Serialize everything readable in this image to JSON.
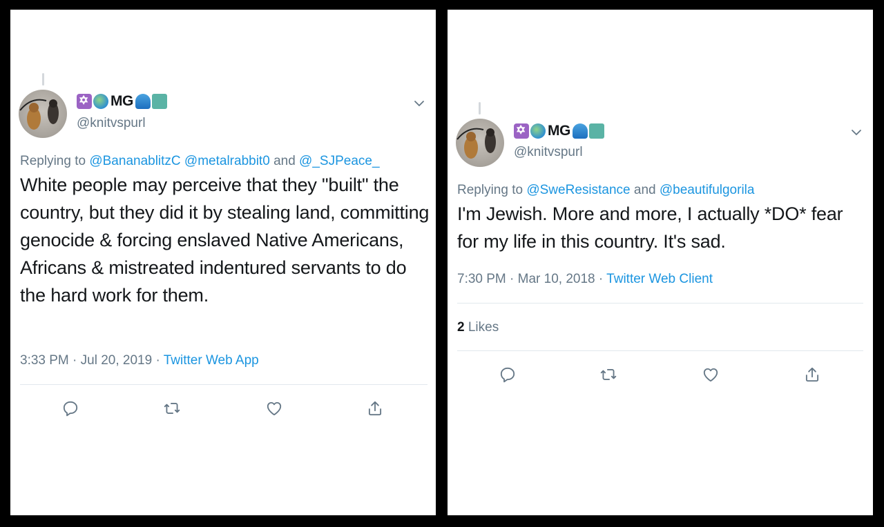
{
  "tweets": [
    {
      "display_name": "MG",
      "handle": "@knitvspurl",
      "replying_prefix": "Replying to",
      "replying_to": "@BananablitzC @metalrabbit0",
      "replying_and": "and",
      "replying_last": "@_SJPeace_",
      "text": "White people may perceive that they \"built\" the country, but they did it by stealing land, committing genocide & forcing enslaved Native Americans, Africans & mistreated indentured servants to do the hard work for them.",
      "time": "3:33 PM",
      "date": "Jul 20, 2019",
      "separator": "·",
      "source": "Twitter Web App",
      "likes_count": null,
      "likes_label": null
    },
    {
      "display_name": "MG",
      "handle": "@knitvspurl",
      "replying_prefix": "Replying to",
      "replying_to": "@SweResistance",
      "replying_and": "and",
      "replying_last": "@beautifulgorila",
      "text": "I'm Jewish. More and more, I actually *DO* fear for my life in this country. It's sad.",
      "time": "7:30 PM",
      "date": "Mar 10, 2018",
      "separator": "·",
      "source": "Twitter Web Client",
      "likes_count": "2",
      "likes_label": "Likes"
    }
  ],
  "icons": {
    "emojis": [
      "star-of-david-icon",
      "globe-icon",
      "wave-icon",
      "statue-of-liberty-icon"
    ],
    "actions": [
      "reply-icon",
      "retweet-icon",
      "like-icon",
      "share-icon"
    ],
    "menu": "chevron-down-icon"
  },
  "colors": {
    "link": "#1b95e0",
    "secondary_text": "#657786",
    "primary_text": "#14171a",
    "background": "#000000"
  }
}
